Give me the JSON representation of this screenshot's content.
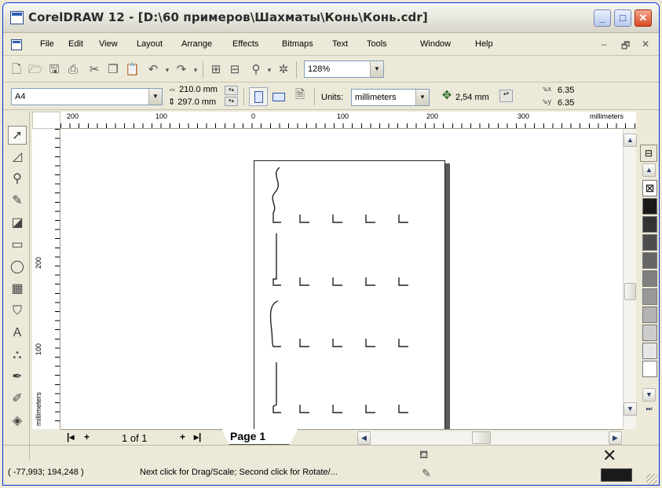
{
  "window": {
    "title": "CorelDRAW 12 - [D:\\60 примеров\\Шахматы\\Конь\\Конь.cdr]",
    "buttons": {
      "minimize": "_",
      "maximize": "□",
      "close": "✕"
    }
  },
  "menu": {
    "items": [
      "File",
      "Edit",
      "View",
      "Layout",
      "Arrange",
      "Effects",
      "Bitmaps",
      "Text",
      "Tools",
      "Window",
      "Help"
    ],
    "doc_controls": [
      "–",
      "🗗",
      "✕"
    ]
  },
  "standard_toolbar": {
    "icons": [
      "new-icon",
      "open-icon",
      "save-icon",
      "print-icon",
      "cut-icon",
      "copy-icon",
      "paste-icon",
      "undo-icon",
      "redo-icon",
      "import-icon",
      "export-icon",
      "app-launcher-icon",
      "corel-online-icon"
    ],
    "zoom": "128%"
  },
  "property_bar": {
    "paper_type": "A4",
    "width": "210.0 mm",
    "height": "297.0 mm",
    "units_label": "Units:",
    "units_value": "millimeters",
    "nudge": "2,54 mm",
    "dup_x": "6.35",
    "dup_y": "6.35"
  },
  "rulers": {
    "h_labels": [
      "200",
      "100",
      "0",
      "100",
      "200",
      "300",
      "millimeters"
    ],
    "v_labels": [
      "200",
      "100",
      "millimeters"
    ]
  },
  "page_nav": {
    "page_count": "1 of 1",
    "tab_label": "Page 1"
  },
  "palette": {
    "colors": [
      "#1a1a1a",
      "#333333",
      "#4d4d4d",
      "#666666",
      "#808080",
      "#999999",
      "#b3b3b3",
      "#cccccc",
      "#e6e6e6",
      "#ffffff"
    ]
  },
  "status": {
    "coords": "( -77,993; 194,248 )",
    "message": "Next click for Drag/Scale; Second click for Rotate/..."
  }
}
